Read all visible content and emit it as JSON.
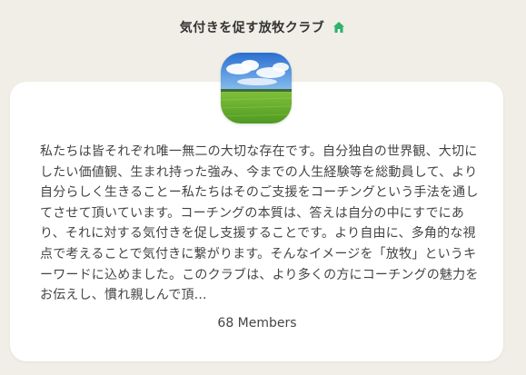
{
  "club": {
    "title": "気付きを促す放牧クラブ",
    "home_icon": "home-icon",
    "avatar_icon": "green-meadow-landscape",
    "description": "私たちは皆それぞれ唯一無二の大切な存在です。自分独自の世界観、大切にしたい価値観、生まれ持った強み、今までの人生経験等を総動員して、より自分らしく生きることー私たちはそのご支援をコーチングという手法を通してさせて頂いています。コーチングの本質は、答えは自分の中にすでにあり、それに対する気付きを促し支援することです。より自由に、多角的な視点で考えることで気付きに繋がります。そんなイメージを「放牧」というキーワードに込めました。このクラブは、より多くの方にコーチングの魅力をお伝えし、慣れ親しんで頂...",
    "members": "68 Members"
  },
  "colors": {
    "background": "#f0eee6",
    "card": "#ffffff",
    "home_icon": "#2fb36a"
  }
}
